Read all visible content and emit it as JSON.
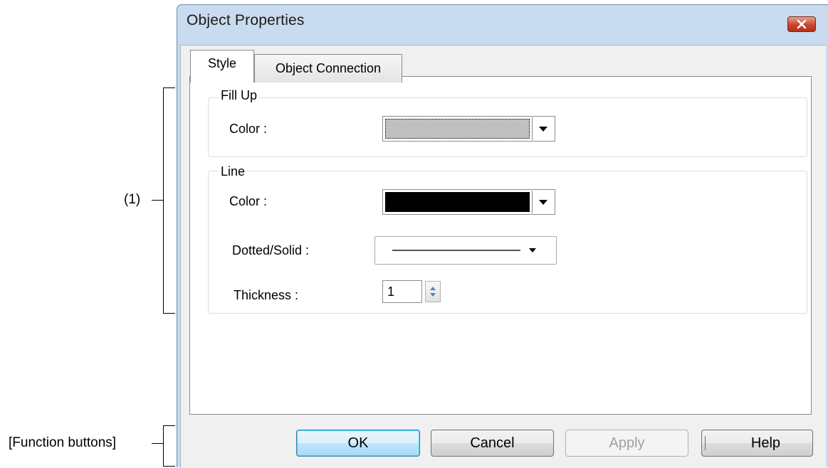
{
  "annotations": {
    "area_label": "(1)",
    "buttons_label": "[Function buttons]"
  },
  "dialog": {
    "title": "Object Properties",
    "close_icon": "close-icon",
    "tabs": [
      {
        "label": "Style",
        "active": true
      },
      {
        "label": "Object Connection",
        "active": false
      }
    ]
  },
  "fill_up": {
    "group_label": "Fill Up",
    "color_label": "Color :",
    "color_value": "#c0c0c0"
  },
  "line": {
    "group_label": "Line",
    "color_label": "Color :",
    "color_value": "#000000",
    "style_label": "Dotted/Solid :",
    "style_value": "solid",
    "thickness_label": "Thickness :",
    "thickness_value": "1"
  },
  "buttons": {
    "ok": "OK",
    "cancel": "Cancel",
    "apply": "Apply",
    "help": "Help"
  },
  "colors": {
    "titlebar": "#c9dbee",
    "close_button": "#c8452f",
    "default_button_border": "#3c7fb1"
  }
}
